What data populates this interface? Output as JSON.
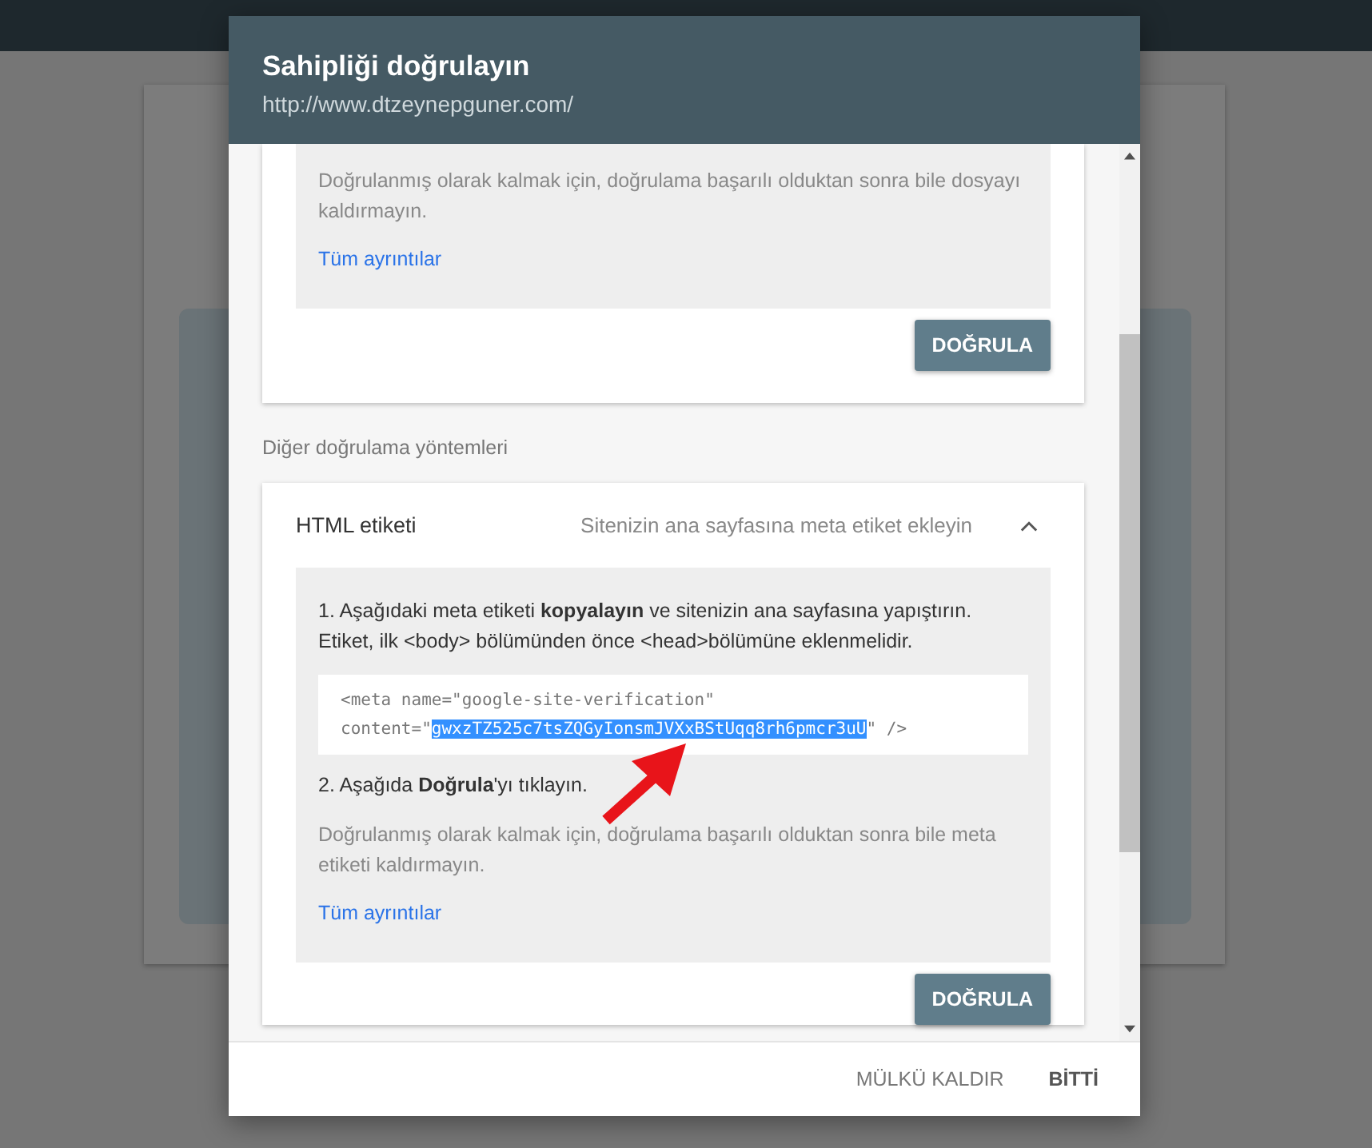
{
  "dialog": {
    "title": "Sahipliği doğrulayın",
    "subtitle": "http://www.dtzeynepguner.com/"
  },
  "first_method": {
    "note": "Doğrulanmış olarak kalmak için, doğrulama başarılı olduktan sonra bile dosyayı kaldırmayın.",
    "link": "Tüm ayrıntılar",
    "button": "DOĞRULA"
  },
  "section_label": "Diğer doğrulama yöntemleri",
  "html_tag_method": {
    "title": "HTML etiketi",
    "description": "Sitenizin ana sayfasına meta etiket ekleyin",
    "expanded": true,
    "step_1": "1. Aşağıdaki meta etiketi **kopyalayın** ve sitenizin ana sayfasına yapıştırın. Etiket, ilk <body> bölümünden önce <head>bölümüne eklenmelidir.",
    "code": {
      "line_1": "<meta name=\"google-site-verification\"",
      "prefix": "content=\"",
      "token": "gwxzTZ525c7tsZQGyIonsmJVXxBStUqq8rh6pmcr3uU",
      "token_selected": true,
      "suffix": "\" />"
    },
    "step_2": "2. Aşağıda **Doğrula**'yı tıklayın.",
    "note": "Doğrulanmış olarak kalmak için, doğrulama başarılı olduktan sonra bile meta etiketi kaldırmayın.",
    "link": "Tüm ayrıntılar",
    "button": "DOĞRULA"
  },
  "footer_buttons": [
    {
      "label": "MÜLKÜ KALDIR",
      "kind": "secondary"
    },
    {
      "label": "BİTTİ",
      "kind": "primary"
    }
  ]
}
